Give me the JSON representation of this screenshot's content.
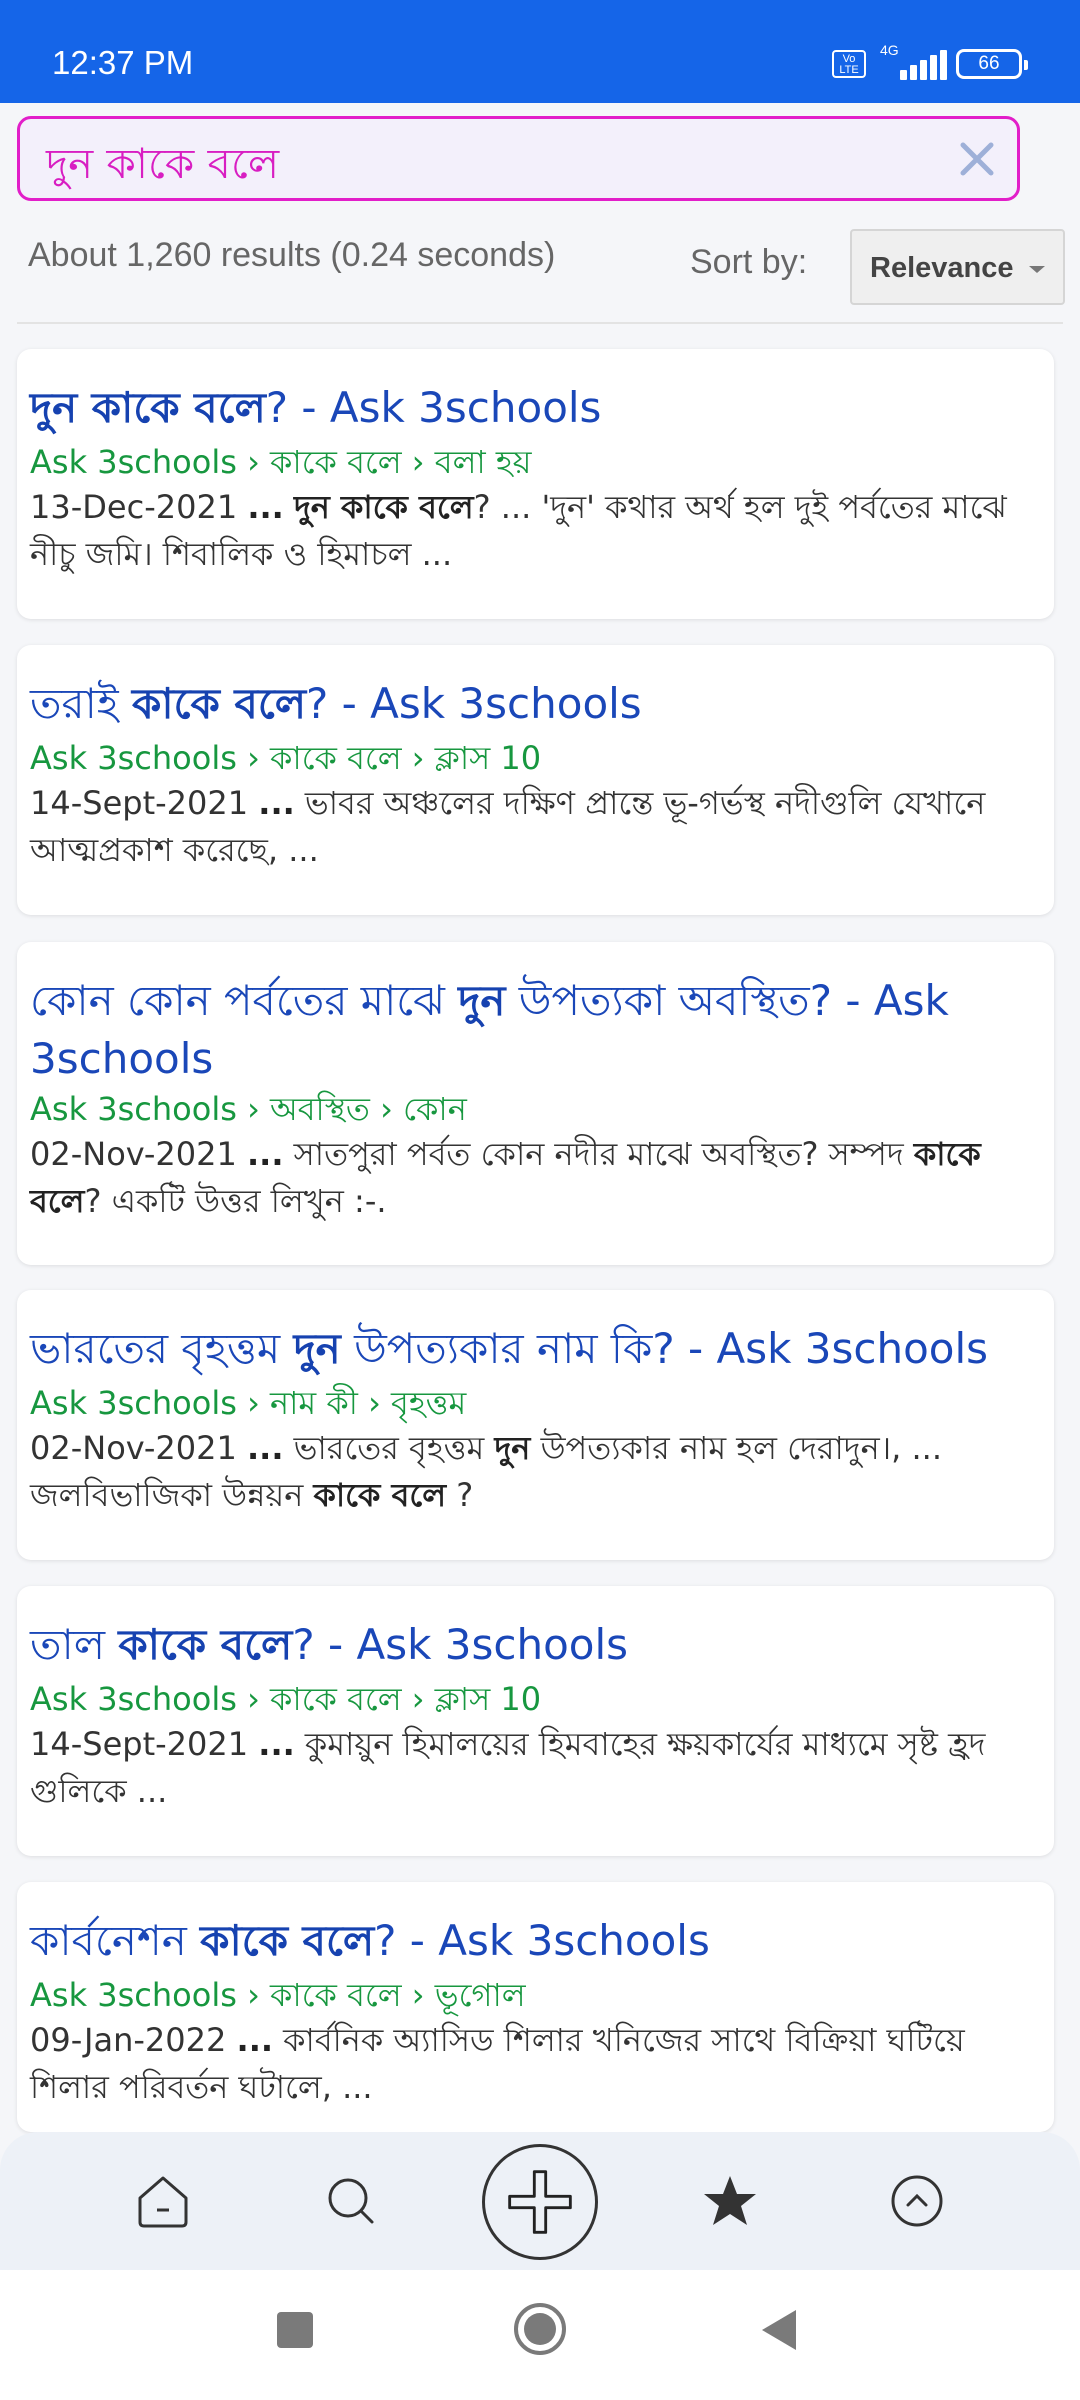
{
  "status_bar": {
    "time": "12:37 PM",
    "volte": "Vo LTE",
    "network": "4G",
    "battery": "66"
  },
  "search": {
    "query": "দুন কাকে বলে"
  },
  "results_meta": "About 1,260 results (0.24 seconds)",
  "sort": {
    "label": "Sort by:",
    "value": "Relevance"
  },
  "results": [
    {
      "title_parts": [
        {
          "text": "দুন কাকে বলে",
          "bold": true
        },
        {
          "text": "? - Ask 3schools",
          "bold": false
        }
      ],
      "url": "Ask 3schools › কাকে বলে › বলা হয়",
      "snippet_parts": [
        {
          "text": "13-Dec-2021 ",
          "bold": false
        },
        {
          "text": "...",
          "bold": true
        },
        {
          "text": " ",
          "bold": false
        },
        {
          "text": "দুন কাকে বলে",
          "bold": true
        },
        {
          "text": "? ... 'দুন' কথার অর্থ হল দুই পর্বতের মাঝে নীচু জমি। শিবালিক ও হিমাচল ...",
          "bold": false
        }
      ]
    },
    {
      "title_parts": [
        {
          "text": "তরাই ",
          "bold": false
        },
        {
          "text": "কাকে বলে",
          "bold": true
        },
        {
          "text": "? - Ask 3schools",
          "bold": false
        }
      ],
      "url": "Ask 3schools › কাকে বলে › ক্লাস 10",
      "snippet_parts": [
        {
          "text": "14-Sept-2021 ",
          "bold": false
        },
        {
          "text": "...",
          "bold": true
        },
        {
          "text": " ভাবর অঞ্চলের দক্ষিণ প্রান্তে ভূ-গর্ভস্থ নদীগুলি যেখানে আত্মপ্রকাশ করেছে, ...",
          "bold": false
        }
      ]
    },
    {
      "title_parts": [
        {
          "text": "কোন কোন পর্বতের মাঝে ",
          "bold": false
        },
        {
          "text": "দুন",
          "bold": true
        },
        {
          "text": " উপত্যকা অবস্থিত? - Ask 3schools",
          "bold": false
        }
      ],
      "url": "Ask 3schools › অবস্থিত › কোন",
      "snippet_parts": [
        {
          "text": "02-Nov-2021 ",
          "bold": false
        },
        {
          "text": "...",
          "bold": true
        },
        {
          "text": " সাতপুরা পর্বত কোন নদীর মাঝে অবস্থিত? সম্পদ ",
          "bold": false
        },
        {
          "text": "কাকে বলে",
          "bold": true
        },
        {
          "text": "? একটি উত্তর লিখুন :-.",
          "bold": false
        }
      ]
    },
    {
      "title_parts": [
        {
          "text": "ভারতের বৃহত্তম ",
          "bold": false
        },
        {
          "text": "দুন",
          "bold": true
        },
        {
          "text": " উপত্যকার নাম কি? - Ask 3schools",
          "bold": false
        }
      ],
      "url": "Ask 3schools › নাম কী › বৃহত্তম",
      "snippet_parts": [
        {
          "text": "02-Nov-2021 ",
          "bold": false
        },
        {
          "text": "...",
          "bold": true
        },
        {
          "text": " ভারতের বৃহত্তম ",
          "bold": false
        },
        {
          "text": "দুন",
          "bold": true
        },
        {
          "text": " উপত্যকার নাম হল দেরাদুন।, ... জলবিভাজিকা উন্নয়ন ",
          "bold": false
        },
        {
          "text": "কাকে বলে",
          "bold": true
        },
        {
          "text": " ?",
          "bold": false
        }
      ]
    },
    {
      "title_parts": [
        {
          "text": "তাল ",
          "bold": false
        },
        {
          "text": "কাকে বলে",
          "bold": true
        },
        {
          "text": "? - Ask 3schools",
          "bold": false
        }
      ],
      "url": "Ask 3schools › কাকে বলে › ক্লাস 10",
      "snippet_parts": [
        {
          "text": "14-Sept-2021 ",
          "bold": false
        },
        {
          "text": "...",
          "bold": true
        },
        {
          "text": " কুমায়ুন হিমালয়ের হিমবাহের ক্ষয়কার্যের মাধ্যমে সৃষ্ট হ্রদ গুলিকে ...",
          "bold": false
        }
      ]
    },
    {
      "title_parts": [
        {
          "text": "কার্বনেশন ",
          "bold": false
        },
        {
          "text": "কাকে বলে",
          "bold": true
        },
        {
          "text": "? - Ask 3schools",
          "bold": false
        }
      ],
      "url": "Ask 3schools › কাকে বলে › ভূগোল",
      "snippet_parts": [
        {
          "text": "09-Jan-2022 ",
          "bold": false
        },
        {
          "text": "...",
          "bold": true
        },
        {
          "text": " কার্বনিক অ্যাসিড শিলার খনিজের সাথে বিক্রিয়া ঘটিয়ে শিলার পরিবর্তন ঘটালে, ...",
          "bold": false
        }
      ]
    }
  ],
  "toolbar": {
    "icons": [
      "home-icon",
      "search-icon",
      "add-icon",
      "star-icon",
      "scroll-top-icon"
    ]
  },
  "colors": {
    "status_bar": "#1565e8",
    "search_border": "#e21ec9",
    "link": "#1a47b8",
    "url": "#17973f"
  }
}
